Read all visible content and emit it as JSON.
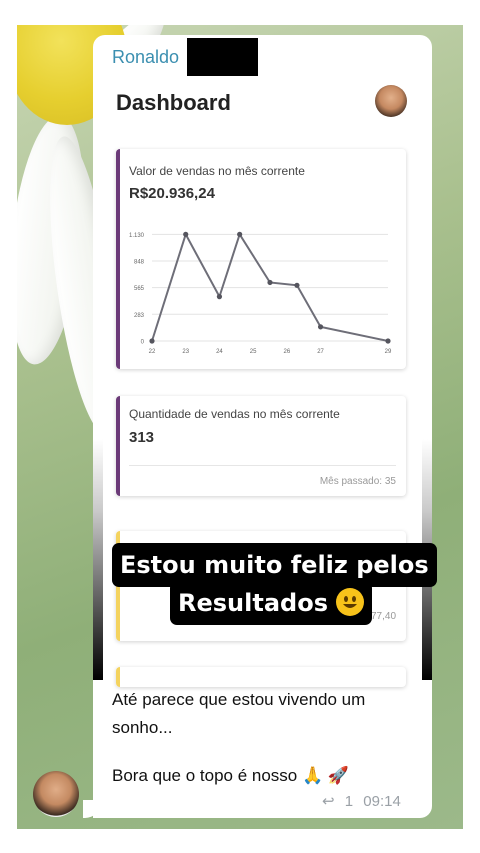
{
  "message": {
    "sender": "Ronaldo",
    "text_line1": "Até parece que estou vivendo um",
    "text_line2": "sonho...",
    "text_line3": "Bora que o topo é nosso",
    "emojis": [
      "🙏",
      "🚀"
    ],
    "reply_count": "1",
    "time": "09:14"
  },
  "screenshot": {
    "title": "Dashboard",
    "card1": {
      "label": "Valor de vendas no mês corrente",
      "value": "R$20.936,24"
    },
    "card2": {
      "label": "Quantidade de vendas no mês corrente",
      "value": "313",
      "footer": "Mês passado: 35"
    },
    "card3": {
      "footer": "...77,40"
    },
    "accent_colors": {
      "purple": "#6b3a78",
      "yellow": "#f4d35e"
    }
  },
  "sticker": {
    "line1": "Estou muito feliz pelos",
    "line2": "Resultados"
  },
  "chart_data": {
    "type": "line",
    "categories": [
      "22",
      "23",
      "24",
      "25",
      "26",
      "27",
      "29"
    ],
    "x": [
      22,
      23,
      24,
      24.6,
      25.5,
      26.3,
      27,
      29
    ],
    "values": [
      0,
      1130,
      470,
      1130,
      620,
      590,
      150,
      0
    ],
    "ytick_labels": [
      "0",
      "283",
      "565",
      "848",
      "1.130"
    ],
    "yticks": [
      0,
      283,
      565,
      848,
      1130
    ],
    "ylim": [
      0,
      1250
    ],
    "grid": true,
    "line_color": "#6e6e78"
  }
}
